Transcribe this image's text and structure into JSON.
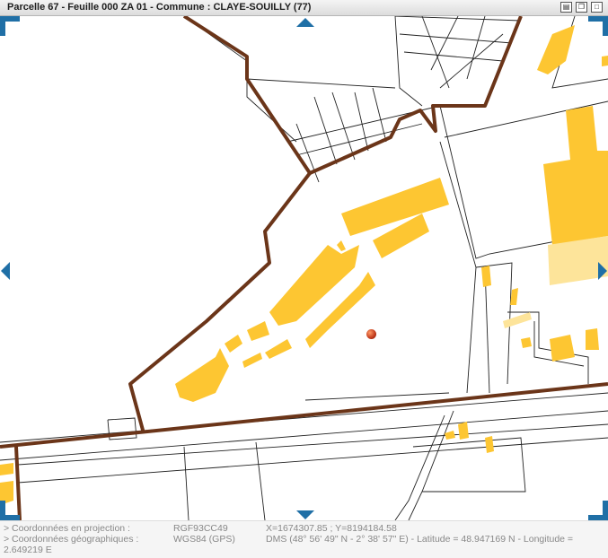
{
  "window": {
    "title": "Parcelle 67 - Feuille 000 ZA 01 - Commune : CLAYE-SOUILLY (77)",
    "icons": [
      "print-icon",
      "restore-window-icon",
      "maximize-icon"
    ]
  },
  "map": {
    "colors": {
      "boundary": "#6b3519",
      "building": "#fdc632",
      "building_light": "#fde49a",
      "parcel_line": "#222222",
      "nav_accent": "#1f6fa6"
    },
    "nav_arrows": [
      "pan-up",
      "pan-down",
      "pan-left",
      "pan-right"
    ]
  },
  "footer": {
    "proj_label": "> Coordonnées en projection :",
    "proj_system": "RGF93CC49",
    "proj_value": "X=1674307.85 ; Y=8194184.58",
    "geo_label": "> Coordonnées géographiques :",
    "geo_system": "WGS84 (GPS)",
    "geo_value": "DMS (48° 56' 49\" N - 2° 38' 57\" E) - Latitude = 48.947169 N - Longitude =",
    "geo_value_cont": "2.649219 E"
  }
}
